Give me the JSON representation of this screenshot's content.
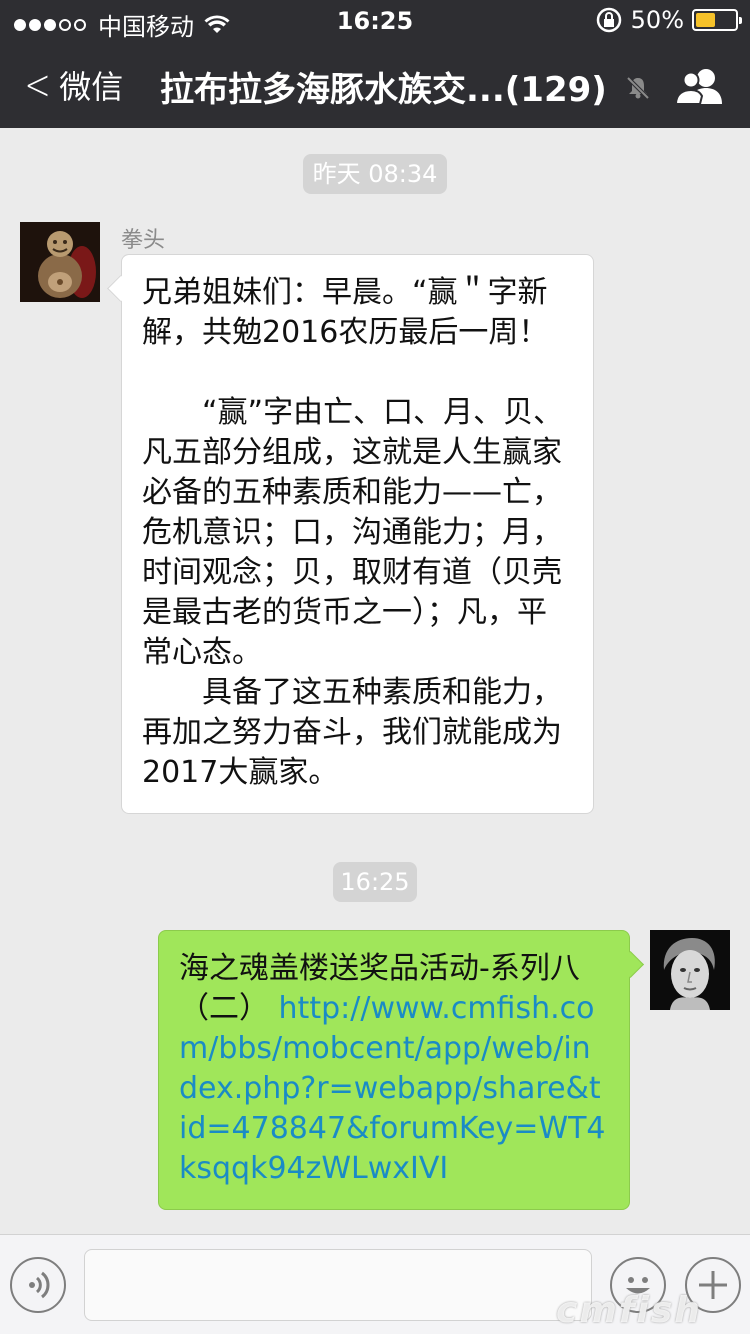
{
  "status_bar": {
    "carrier": "中国移动",
    "time": "16:25",
    "battery_percent": "50%",
    "battery_level": 0.5
  },
  "nav": {
    "back_label": "微信",
    "title": "拉布拉多海豚水族交...(129)"
  },
  "messages": [
    {
      "type": "timestamp",
      "text": "昨天 08:34"
    },
    {
      "type": "incoming",
      "sender": "拳头",
      "text": "兄弟姐妹们：早晨。“赢＂字新解，共勉2016农历最后一周！\n\n　　“赢”字由亡、口、月、贝、凡五部分组成，这就是人生赢家必备的五种素质和能力——亡，危机意识；口，沟通能力；月，时间观念；贝，取财有道（贝壳是最古老的货币之一）；凡，平常心态。\n　　具备了这五种素质和能力，再加之努力奋斗，我们就能成为2017大赢家。"
    },
    {
      "type": "timestamp",
      "text": "16:25"
    },
    {
      "type": "outgoing",
      "text": "海之魂盖楼送奖品活动-系列八（二）",
      "link": "http://www.cmfish.com/bbs/mobcent/app/web/index.php?r=webapp/share&tid=478847&forumKey=WT4ksqqk94zWLwxIVI"
    }
  ],
  "input": {
    "placeholder": ""
  },
  "watermark": "cmfish"
}
